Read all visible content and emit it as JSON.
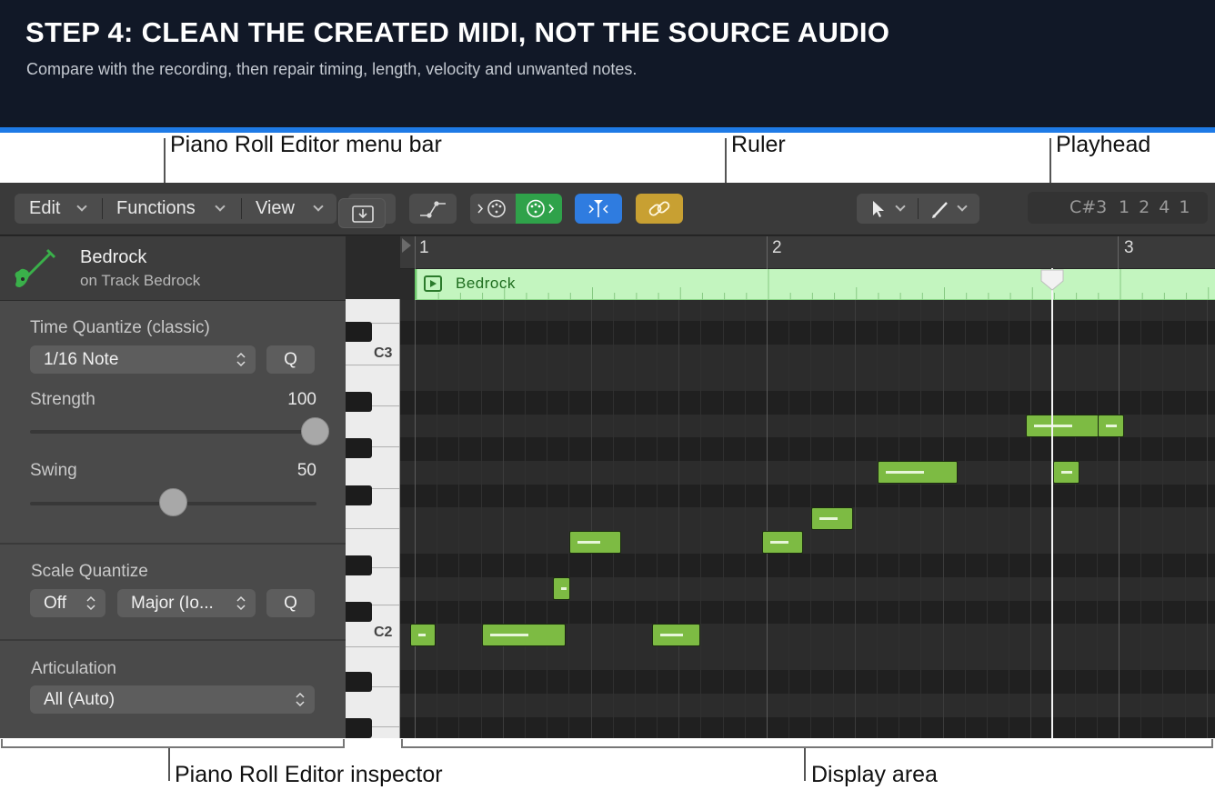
{
  "banner": {
    "title": "STEP 4: CLEAN THE CREATED MIDI, NOT THE SOURCE AUDIO",
    "subtitle": "Compare with the recording, then repair timing, length, velocity and unwanted notes.",
    "accent_color": "#1e7ae6"
  },
  "callouts": {
    "menu_bar": "Piano Roll Editor menu bar",
    "ruler": "Ruler",
    "playhead": "Playhead",
    "inspector": "Piano Roll Editor inspector",
    "display_area": "Display area"
  },
  "menu": {
    "edit": "Edit",
    "functions": "Functions",
    "view": "View",
    "tools": [
      "horizontal-zoom-icon",
      "automation-curve-icon",
      "midi-in-icon",
      "midi-out-icon",
      "catch-playhead-icon",
      "link-icon"
    ],
    "pointer_tool": "pointer-tool-icon",
    "pencil_tool": "pencil-tool-icon"
  },
  "lcd": {
    "pitch": "C#3",
    "position": "1 2 4 1"
  },
  "inspector": {
    "region_name": "Bedrock",
    "track_label": "on Track Bedrock",
    "time_quantize_label": "Time Quantize (classic)",
    "time_quantize_value": "1/16 Note",
    "q_button": "Q",
    "strength_label": "Strength",
    "strength_value": "100",
    "strength_level": 1.0,
    "swing_label": "Swing",
    "swing_value": "50",
    "swing_level": 0.5,
    "scale_quantize_label": "Scale Quantize",
    "scale_quantize_root": "Off",
    "scale_quantize_scale": "Major (Io...",
    "articulation_label": "Articulation",
    "articulation_value": "All (Auto)"
  },
  "keyboard": {
    "labels": [
      "C3",
      "C2"
    ]
  },
  "ruler": {
    "bars": [
      "1",
      "2",
      "3"
    ]
  },
  "region": {
    "name": "Bedrock",
    "color": "#c3f5bf"
  },
  "notes": {
    "color": "#7dbb43",
    "items": [
      {
        "pitch": "C2",
        "start": "1 1 1 1"
      },
      {
        "pitch": "C2",
        "start": "1 1 4 2"
      },
      {
        "pitch": "D2",
        "start": "1 2 3 3"
      },
      {
        "pitch": "E2",
        "start": "1 2 4 2"
      },
      {
        "pitch": "C2",
        "start": "1 3 4 1"
      },
      {
        "pitch": "E2",
        "start": "2 1 1 1"
      },
      {
        "pitch": "F2",
        "start": "2 1 3 2"
      },
      {
        "pitch": "G2",
        "start": "2 2 2 2"
      },
      {
        "pitch": "A2",
        "start": "2 4 1 1"
      },
      {
        "pitch": "G2",
        "start": "2 4 2 2"
      },
      {
        "pitch": "A2",
        "start": "2 4 4 2"
      }
    ]
  }
}
